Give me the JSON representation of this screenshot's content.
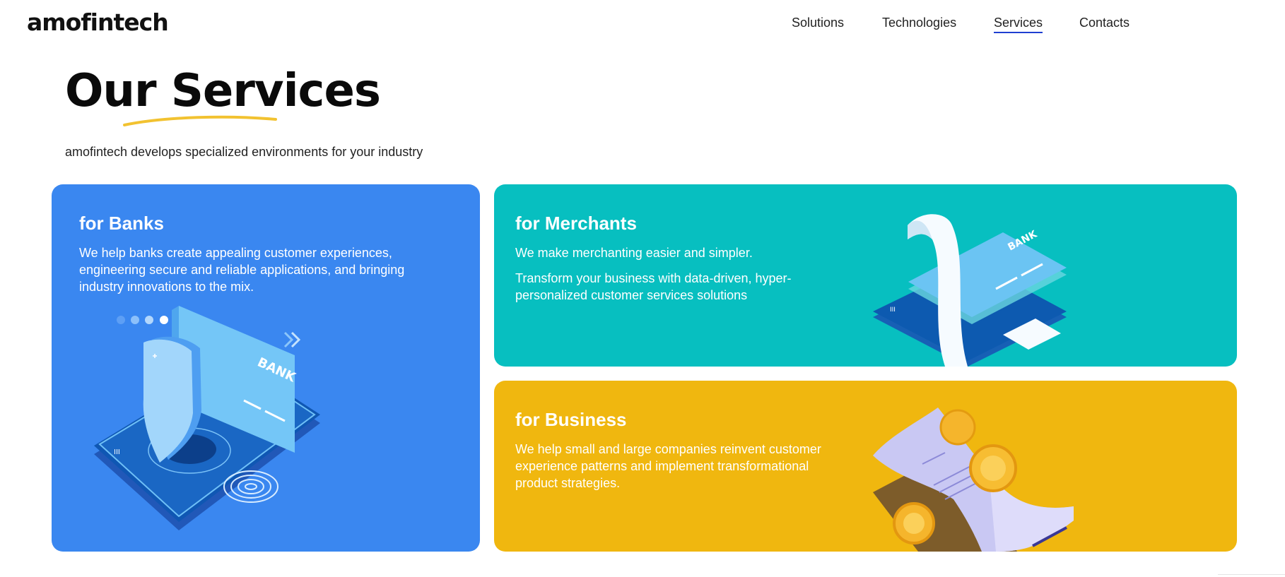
{
  "header": {
    "logo": "amofintech",
    "nav": [
      {
        "label": "Solutions",
        "active": false
      },
      {
        "label": "Technologies",
        "active": false
      },
      {
        "label": "Services",
        "active": true
      },
      {
        "label": "Contacts",
        "active": false
      }
    ]
  },
  "hero": {
    "title": "Our Services",
    "subtitle": "amofintech develops specialized environments for your industry"
  },
  "cards": {
    "banks": {
      "title": "for Banks",
      "text": "We help banks create appealing customer experiences, engineering secure and reliable applications, and bringing industry innovations to the mix.",
      "illustration_label": "BANK",
      "color": "#3a87f0"
    },
    "merchants": {
      "title": "for Merchants",
      "text1": "We make merchanting easier and simpler.",
      "text2": "Transform your business with data-driven, hyper-personalized customer services solutions",
      "illustration_label": "BANK",
      "color": "#07bfc0"
    },
    "business": {
      "title": "for Business",
      "text": "We help small and large companies reinvent customer experience patterns and implement transformational product strategies.",
      "color": "#f0b70f"
    }
  },
  "colors": {
    "accent_underline": "#f2c230",
    "nav_active": "#1f3fd1"
  }
}
